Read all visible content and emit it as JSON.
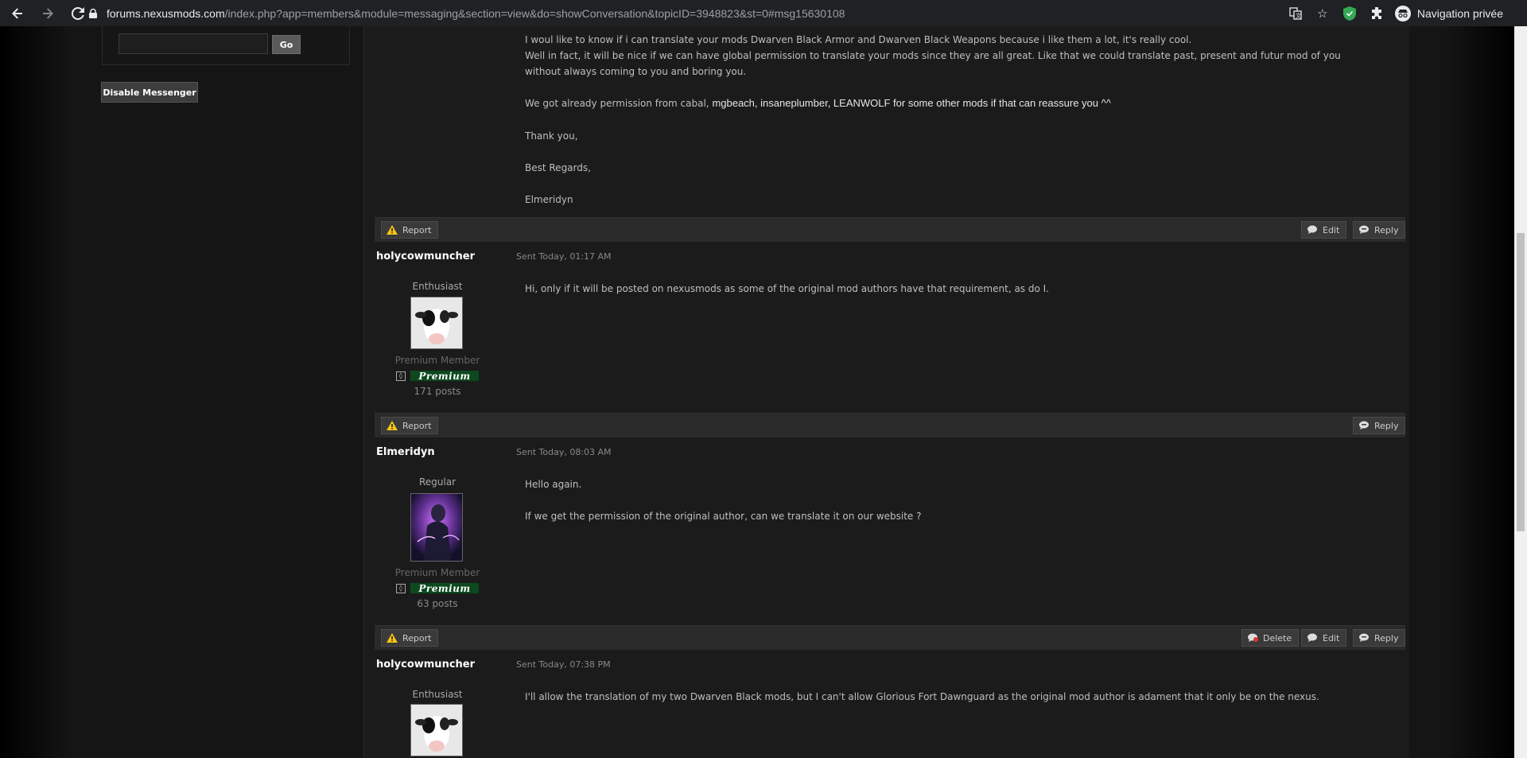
{
  "browser": {
    "url_domain": "forums.nexusmods.com",
    "url_path": "/index.php?app=members&module=messaging&section=view&do=showConversation&topicID=3948823&st=0#msg15630108",
    "profile_label": "Navigation privée"
  },
  "sidebar": {
    "go_label": "Go",
    "disable_label": "Disable Messenger"
  },
  "first_message": {
    "lines": [
      "I woul like to know if i can translate your mods Dwarven Black Armor and Dwarven Black Weapons because i like them a lot, it's really cool.",
      "Well in fact, it will be nice if we can have global permission to translate your mods since they are all great. Like that we could translate past, present and futur mod of you",
      "without always coming to you and boring you."
    ],
    "permission_prefix": "We got already permission from cabal, ",
    "permission_rest": "mgbeach, insaneplumber, LEANWOLF for some other mods if that can reassure you ^^",
    "thanks": "Thank you,",
    "regards": "Best Regards,",
    "signature": "Elmeridyn"
  },
  "buttons": {
    "report": "Report",
    "edit": "Edit",
    "reply": "Reply",
    "delete": "Delete"
  },
  "posts": [
    {
      "author": "holycowmuncher",
      "sent": "Sent Today, 01:17 AM",
      "rank": "Enthusiast",
      "member_type": "Premium Member",
      "badge": "Premium",
      "post_count": "171 posts",
      "body": "Hi, only if it will be posted on nexusmods as some of the original mod authors have that requirement, as do I."
    },
    {
      "author": "Elmeridyn",
      "sent": "Sent Today, 08:03 AM",
      "rank": "Regular",
      "member_type": "Premium Member",
      "badge": "Premium",
      "post_count": "63 posts",
      "body_lines": [
        "Hello again.",
        "If we get the permission of the original author, can we translate it on our website ?"
      ]
    },
    {
      "author": "holycowmuncher",
      "sent": "Sent Today, 07:38 PM",
      "rank": "Enthusiast",
      "body": "I'll allow the translation of my two Dwarven Black mods, but I can't allow Glorious Fort Dawnguard as the original mod author is adament that it only be on the nexus."
    }
  ]
}
